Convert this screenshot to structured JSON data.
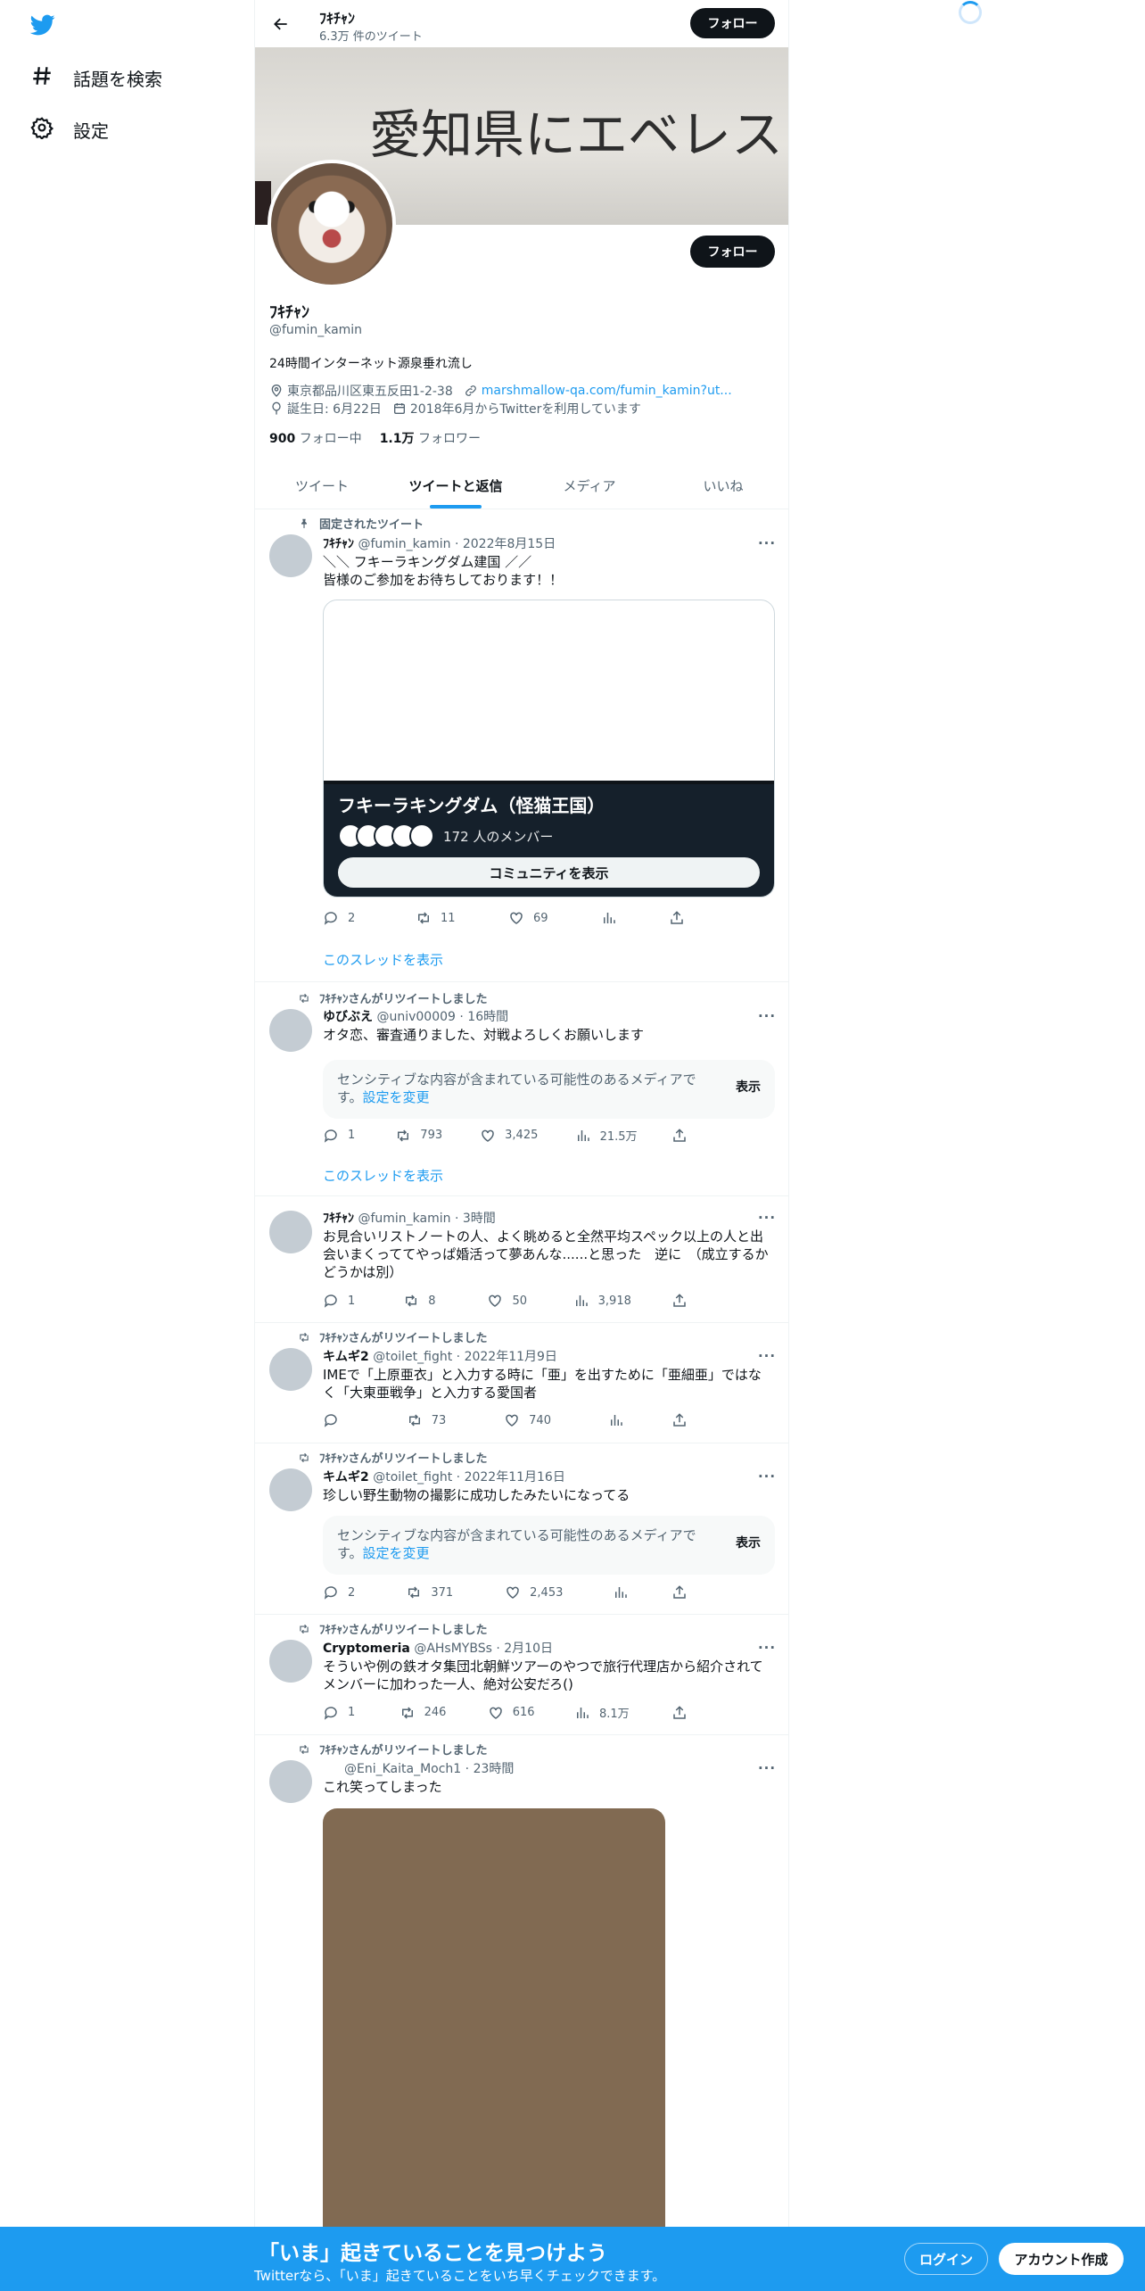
{
  "sidebar": {
    "logo": "twitter-bird-icon",
    "items": [
      {
        "label": "話題を検索",
        "icon": "hashtag-icon"
      },
      {
        "label": "設定",
        "icon": "gear-icon"
      }
    ]
  },
  "header": {
    "title": "ﾌｷﾁｬﾝ",
    "subtitle": "6.3万 件のツイート",
    "follow_label": "フォロー"
  },
  "banner": {
    "handwriting": "愛知県にエベレストは無い"
  },
  "profile": {
    "name": "ﾌｷﾁｬﾝ",
    "handle": "@fumin_kamin",
    "bio": "24時間インターネット源泉垂れ流し",
    "follow_label": "フォロー",
    "location": "東京都品川区東五反田1-2-38",
    "website": "marshmallow-qa.com/fumin_kamin?ut...",
    "birthday": "誕生日: 6月22日",
    "joined": "2018年6月からTwitterを利用しています",
    "following_count": "900",
    "following_label": "フォロー中",
    "followers_count": "1.1万",
    "followers_label": "フォロワー"
  },
  "tabs": [
    {
      "label": "ツイート",
      "active": false
    },
    {
      "label": "ツイートと返信",
      "active": true
    },
    {
      "label": "メディア",
      "active": false
    },
    {
      "label": "いいね",
      "active": false
    }
  ],
  "tweets": [
    {
      "social": "固定されたツイート",
      "name": "ﾌｷﾁｬﾝ",
      "handle": "@fumin_kamin",
      "time": "2022年8月15日",
      "text_lines": [
        "＼＼ フキーラキングダム建国 ／／",
        "皆様のご参加をお待ちしております！！"
      ],
      "community": {
        "name": "フキーラキングダム（怪猫王国）",
        "members": "172 人のメンバー",
        "button": "コミュニティを表示"
      },
      "replies": "2",
      "retweets": "11",
      "likes": "69",
      "views": "",
      "thread_link": "このスレッドを表示"
    },
    {
      "social": "ﾌｷﾁｬﾝさんがリツイートしました",
      "name": "ゆびぶえ",
      "handle": "@univ00009",
      "time": "16時間",
      "text_lines": [
        "オタ恋、審査通りました、対戦よろしくお願いします"
      ],
      "sensitive": {
        "text": "センシティブな内容が含まれている可能性のあるメディアです。",
        "link": "設定を変更",
        "button": "表示"
      },
      "replies": "1",
      "retweets": "793",
      "likes": "3,425",
      "views": "21.5万",
      "thread_link": "このスレッドを表示"
    },
    {
      "name": "ﾌｷﾁｬﾝ",
      "handle": "@fumin_kamin",
      "time": "3時間",
      "text_lines": [
        "お見合いリストノートの人、よく眺めると全然平均スペック以上の人と出",
        "会いまくっててやっぱ婚活って夢あんな......と思った　逆に　（成立するか",
        "どうかは別）"
      ],
      "replies": "1",
      "retweets": "8",
      "likes": "50",
      "views": "3,918"
    },
    {
      "social": "ﾌｷﾁｬﾝさんがリツイートしました",
      "name": "キムギ2",
      "handle": "@toilet_fight",
      "time": "2022年11月9日",
      "text_lines": [
        "IMEで「上原亜衣」と入力する時に「亜」を出すために「亜細亜」ではな",
        "く「大東亜戦争」と入力する愛国者"
      ],
      "replies": "",
      "retweets": "73",
      "likes": "740",
      "views": ""
    },
    {
      "social": "ﾌｷﾁｬﾝさんがリツイートしました",
      "name": "キムギ2",
      "handle": "@toilet_fight",
      "time": "2022年11月16日",
      "text_lines": [
        "珍しい野生動物の撮影に成功したみたいになってる"
      ],
      "sensitive": {
        "text": "センシティブな内容が含まれている可能性のあるメディアです。",
        "link": "設定を変更",
        "button": "表示"
      },
      "replies": "2",
      "retweets": "371",
      "likes": "2,453",
      "views": ""
    },
    {
      "social": "ﾌｷﾁｬﾝさんがリツイートしました",
      "name": "Cryptomeria",
      "handle": "@AHsMYBSs",
      "time": "2月10日",
      "text_lines": [
        "そういや例の鉄オタ集団北朝鮮ツアーのやつで旅行代理店から紹介されて",
        "メンバーに加わった一人、絶対公安だろ()"
      ],
      "replies": "1",
      "retweets": "246",
      "likes": "616",
      "views": "8.1万"
    },
    {
      "social": "ﾌｷﾁｬﾝさんがリツイートしました",
      "name": "",
      "handle": "@Eni_Kaita_Moch1",
      "time": "23時間",
      "text_lines": [
        "これ笑ってしまった"
      ]
    }
  ],
  "more_icon": "more-dots-icon",
  "bottom_bar": {
    "title": "「いま」起きていることを見つけよう",
    "subtitle": "Twitterなら、「いま」起きていることをいち早くチェックできます。",
    "login": "ログイン",
    "signup": "アカウント作成"
  },
  "colors": {
    "accent": "#1d9bf0",
    "text": "#0f1419",
    "muted": "#536471",
    "button_dark": "#0f1419"
  }
}
